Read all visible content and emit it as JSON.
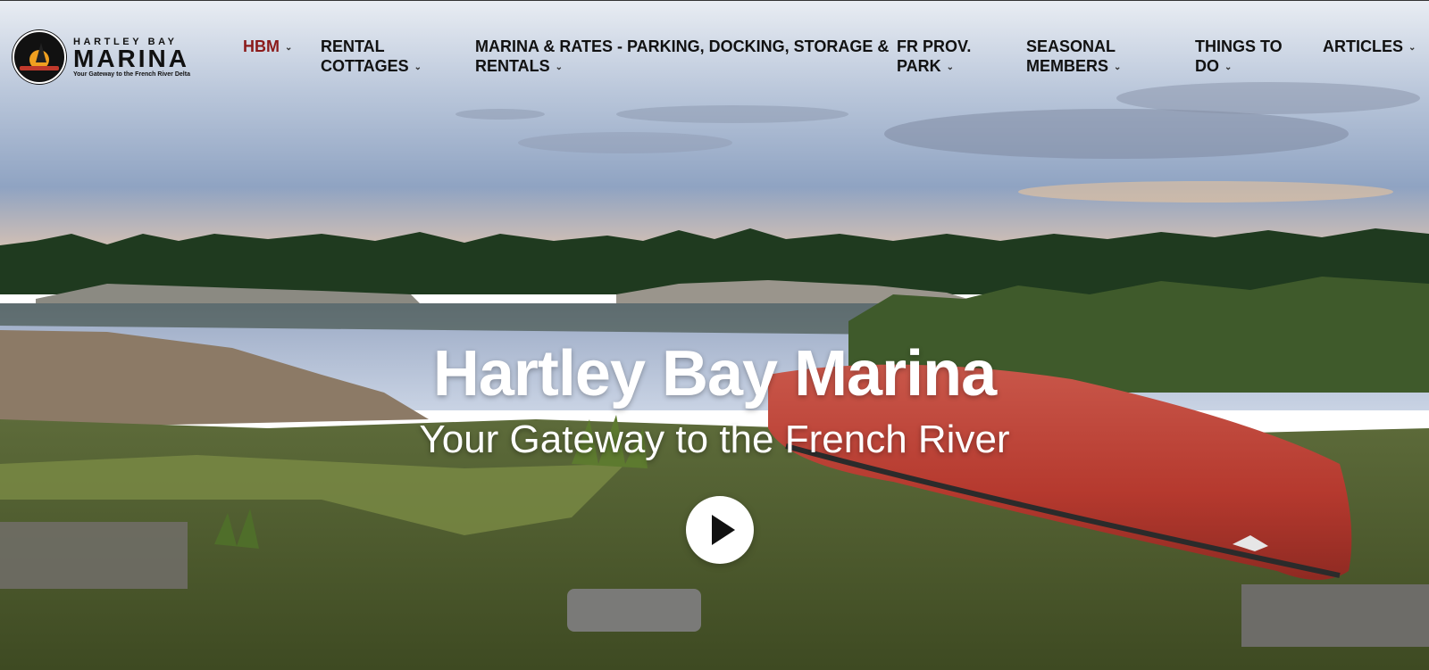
{
  "logo": {
    "top_text": "HARTLEY BAY",
    "main_text": "MARINA",
    "tagline": "Your Gateway to the French River Delta"
  },
  "nav": {
    "items": [
      {
        "line1": "HBM",
        "line2": "",
        "active": true
      },
      {
        "line1": "RENTAL",
        "line2": "COTTAGES"
      },
      {
        "line1": "MARINA & RATES - PARKING, DOCKING, STORAGE &",
        "line2": "RENTALS"
      },
      {
        "line1": "FR PROV.",
        "line2": "PARK"
      },
      {
        "line1": "SEASONAL",
        "line2": "MEMBERS"
      },
      {
        "line1": "THINGS TO",
        "line2": "DO"
      },
      {
        "line1": "ARTICLES",
        "line2": ""
      }
    ],
    "chevron_icon": "chevron-down-icon",
    "active_color": "#8b1a1a"
  },
  "hero": {
    "title": "Hartley Bay Marina",
    "subtitle": "Your Gateway to the French River",
    "play_icon": "play-icon"
  }
}
